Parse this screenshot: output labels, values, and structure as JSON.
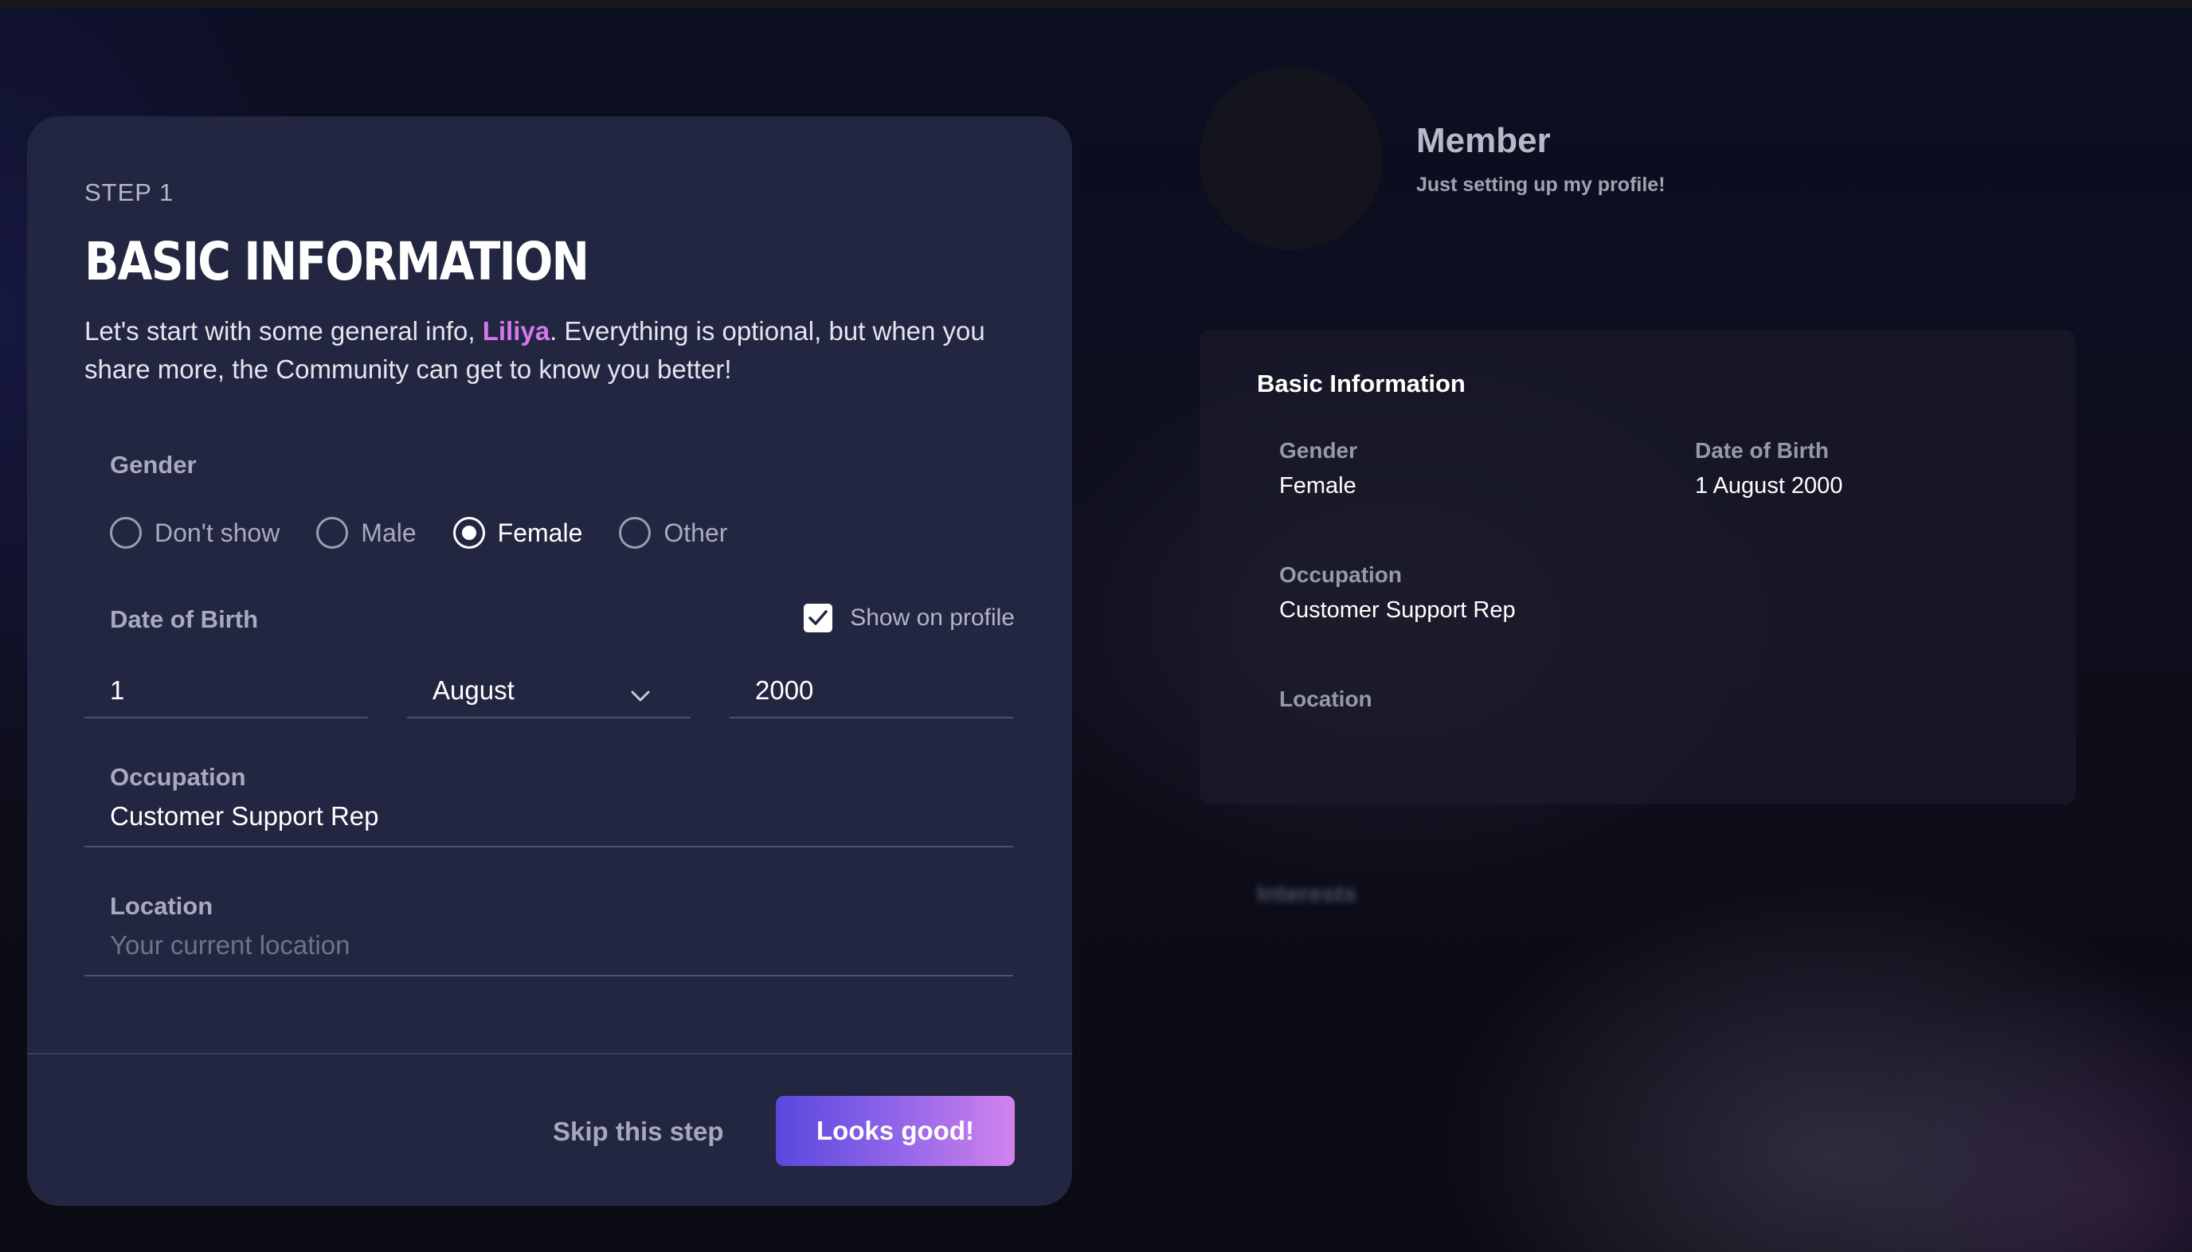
{
  "form": {
    "step_label": "STEP 1",
    "title": "BASIC INFORMATION",
    "intro_before": "Let's start with some general info, ",
    "intro_name": "Liliya",
    "intro_after": ". Everything is optional, but when you share more, the Community can get to know you better!",
    "gender": {
      "label": "Gender",
      "options": [
        "Don't show",
        "Male",
        "Female",
        "Other"
      ],
      "selected": "Female"
    },
    "dob": {
      "label": "Date of Birth",
      "show_on_profile_label": "Show on profile",
      "show_on_profile_checked": true,
      "day": "1",
      "month": "August",
      "year": "2000"
    },
    "occupation": {
      "label": "Occupation",
      "value": "Customer Support Rep"
    },
    "location": {
      "label": "Location",
      "placeholder": "Your current location",
      "value": ""
    },
    "skip_label": "Skip this step",
    "submit_label": "Looks good!"
  },
  "preview": {
    "display_name": "Member",
    "tagline": "Just setting up my profile!",
    "section_title": "Basic Information",
    "gender_label": "Gender",
    "gender_value": "Female",
    "dob_label": "Date of Birth",
    "dob_value": "1 August 2000",
    "occupation_label": "Occupation",
    "occupation_value": "Customer Support Rep",
    "location_label": "Location",
    "next_section_title": "Interests"
  },
  "colors": {
    "accent_name": "#d378ee",
    "button_gradient_start": "#5a48de",
    "button_gradient_end": "#d282ee",
    "card_background": "#222640"
  }
}
